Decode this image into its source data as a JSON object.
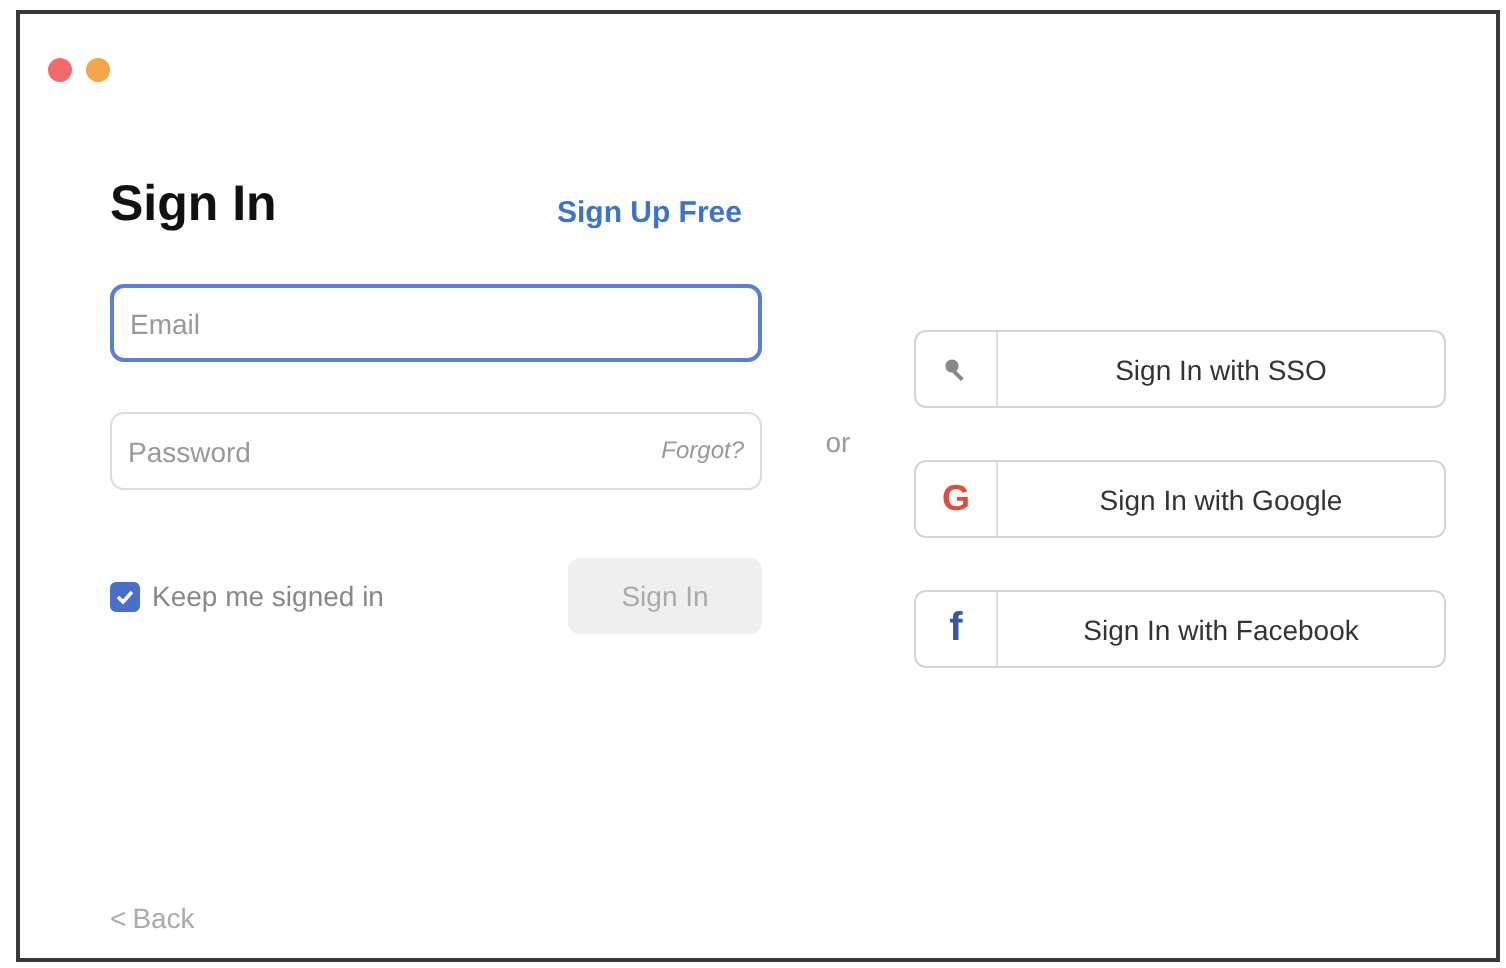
{
  "window": {
    "controls": [
      {
        "kind": "close"
      },
      {
        "kind": "minimize"
      }
    ]
  },
  "title": "Sign In",
  "sign_up_link": "Sign Up Free",
  "email_field": {
    "placeholder": "Email",
    "focused": true
  },
  "password_field": {
    "placeholder": "Password",
    "forgot_link": "Forgot?",
    "focused": false
  },
  "keep_signed_in": {
    "label": "Keep me signed in",
    "checked": true
  },
  "sign_in_button": {
    "label": "Sign In",
    "disabled": true
  },
  "separator": "or",
  "sso_buttons": [
    {
      "kind": "sso",
      "label": "Sign In with SSO"
    },
    {
      "kind": "google",
      "icon": "G",
      "label": "Sign In with Google"
    },
    {
      "kind": "facebook",
      "icon": "f",
      "label": "Sign In with Facebook"
    }
  ],
  "back_link": {
    "icon": "<",
    "label": "Back"
  }
}
